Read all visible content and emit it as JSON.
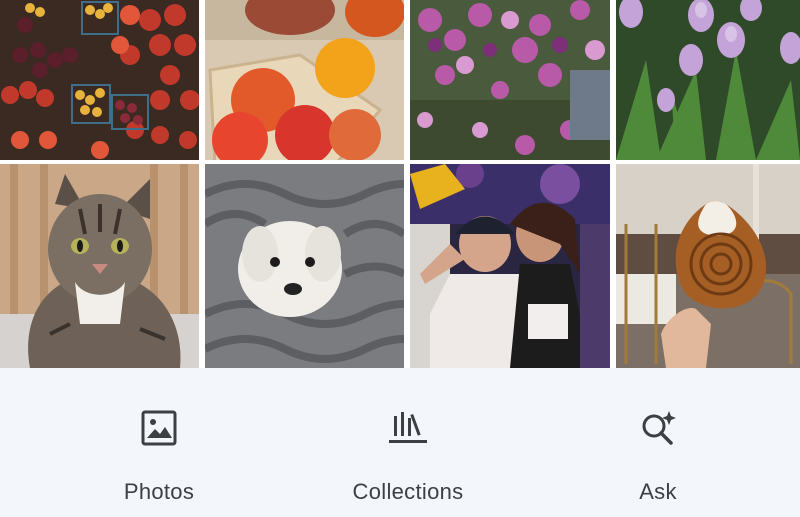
{
  "photos": [
    {
      "name": "photo-tomatoes-market"
    },
    {
      "name": "photo-tomatoes-basket"
    },
    {
      "name": "photo-orchids"
    },
    {
      "name": "photo-tulips"
    },
    {
      "name": "photo-tabby-cat"
    },
    {
      "name": "photo-white-dog-blanket"
    },
    {
      "name": "photo-friends-party"
    },
    {
      "name": "photo-pastry-cafe"
    }
  ],
  "nav": {
    "items": [
      {
        "label": "Photos",
        "icon": "image-icon"
      },
      {
        "label": "Collections",
        "icon": "collections-icon"
      },
      {
        "label": "Ask",
        "icon": "search-sparkle-icon"
      }
    ]
  },
  "colors": {
    "bar_background": "#f3f6fb",
    "label": "#3c4043",
    "icon": "#3c4043"
  }
}
